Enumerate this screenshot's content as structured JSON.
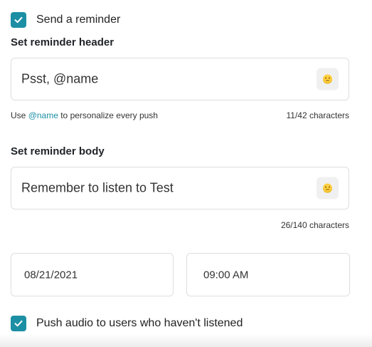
{
  "send_reminder": {
    "checked": true,
    "label": "Send a reminder"
  },
  "header_section": {
    "label": "Set reminder header",
    "value": "Psst, @name",
    "helper_prefix": "Use ",
    "helper_mention": "@name",
    "helper_suffix": " to personalize every push",
    "char_count": "11/42 characters",
    "emoji_icon": "emoji-icon"
  },
  "body_section": {
    "label": "Set reminder body",
    "value": "Remember to listen to Test",
    "char_count": "26/140 characters",
    "emoji_icon": "emoji-icon"
  },
  "schedule": {
    "date": "08/21/2021",
    "time": "09:00 AM"
  },
  "push_audio": {
    "checked": true,
    "label": "Push audio to users who haven't listened"
  },
  "colors": {
    "accent": "#1c8fa4",
    "border": "#dedede"
  }
}
